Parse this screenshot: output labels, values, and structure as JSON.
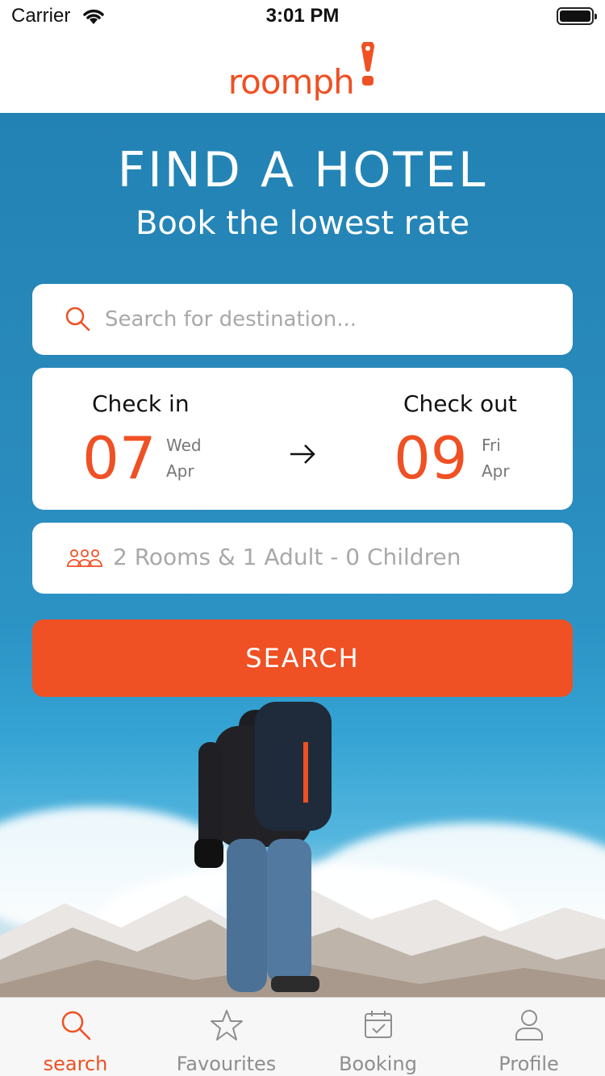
{
  "status_bar": {
    "carrier": "Carrier",
    "time": "3:01 PM"
  },
  "header": {
    "logo_text": "roomph"
  },
  "hero": {
    "title": "FIND A HOTEL",
    "subtitle": "Book the lowest rate"
  },
  "search": {
    "placeholder": "Search for destination..."
  },
  "dates": {
    "check_in": {
      "label": "Check in",
      "day": "07",
      "weekday": "Wed",
      "month": "Apr"
    },
    "check_out": {
      "label": "Check out",
      "day": "09",
      "weekday": "Fri",
      "month": "Apr"
    }
  },
  "guests": {
    "summary": "2 Rooms & 1 Adult - 0 Children"
  },
  "search_button": {
    "label": "SEARCH"
  },
  "tab_bar": {
    "tabs": [
      {
        "label": "search",
        "icon": "search-icon",
        "active": true
      },
      {
        "label": "Favourites",
        "icon": "star-icon",
        "active": false
      },
      {
        "label": "Booking",
        "icon": "calendar-check-icon",
        "active": false
      },
      {
        "label": "Profile",
        "icon": "user-icon",
        "active": false
      }
    ]
  },
  "colors": {
    "accent": "#ef5024",
    "hero_blue": "#2a8bbd",
    "tab_inactive": "#8e8e8e"
  }
}
